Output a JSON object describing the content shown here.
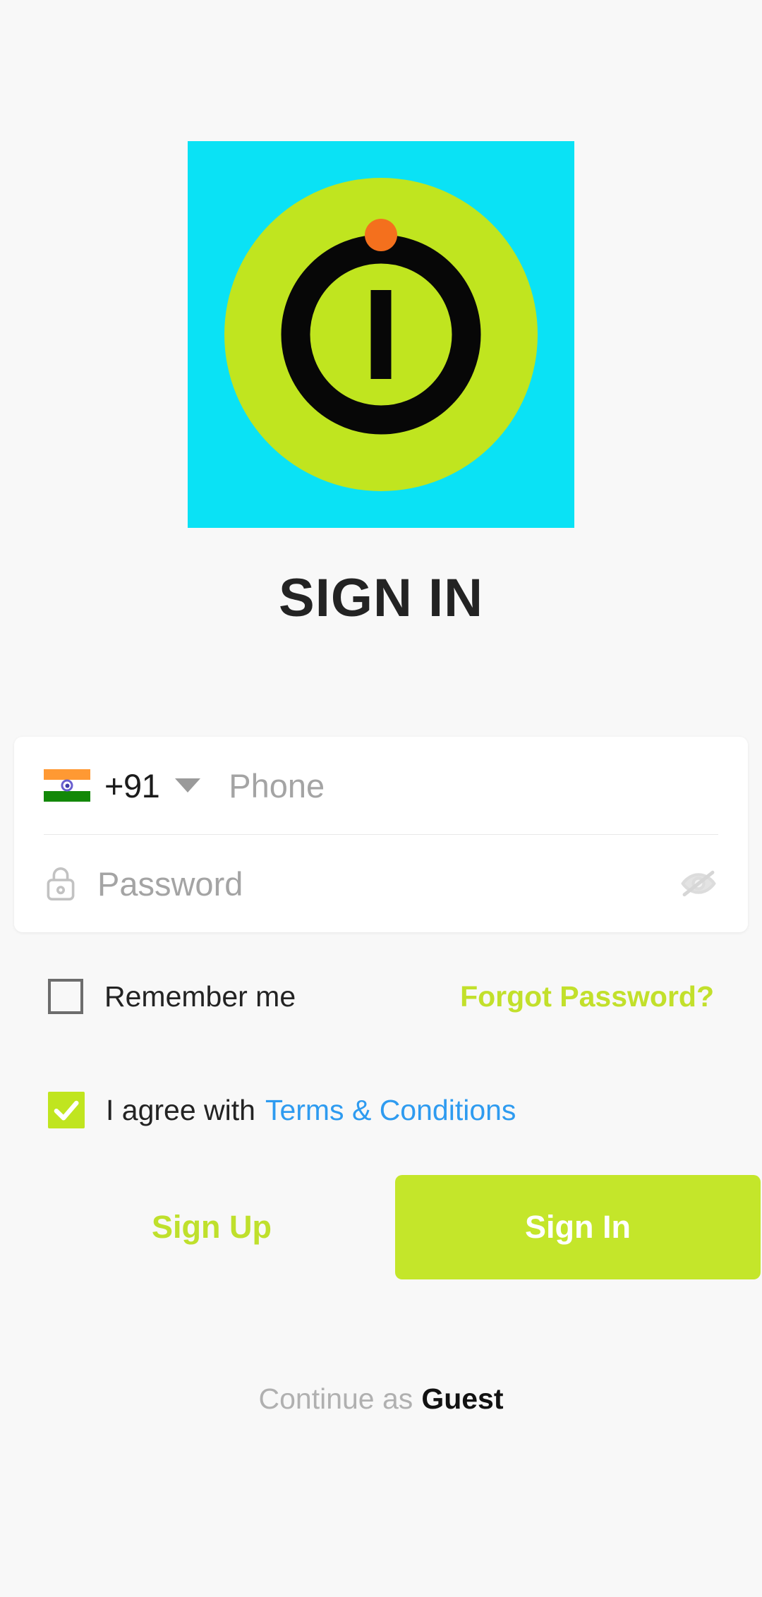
{
  "app": {
    "background_color": "#f8f8f8",
    "accent_color": "#c4e62a",
    "link_color": "#2e9bf0"
  },
  "logo": {
    "square_color": "#0ae2f5",
    "circle_color": "#c0e51f",
    "ring_color": "#070707",
    "dot_color": "#f4701d",
    "bar_color": "#070707",
    "alt": "app-logo"
  },
  "header": {
    "title": "SIGN IN"
  },
  "form": {
    "phone": {
      "flag": "india-flag-icon",
      "dial_code": "+91",
      "dropdown_icon": "chevron-down-icon",
      "placeholder": "Phone",
      "value": ""
    },
    "password": {
      "lock_icon": "lock-icon",
      "placeholder": "Password",
      "value": "",
      "toggle_icon": "eye-off-icon"
    }
  },
  "options": {
    "remember_me": {
      "label": "Remember me",
      "checked": false
    },
    "forgot_password": {
      "label": "Forgot Password?",
      "color": "#c2e02b"
    },
    "terms": {
      "checked": true,
      "prefix": "I agree with",
      "link_label": "Terms & Conditions",
      "link_color": "#2e9bf0",
      "checkbox_color": "#c0e51f"
    }
  },
  "actions": {
    "sign_up": {
      "label": "Sign Up",
      "color": "#bfe02c"
    },
    "sign_in": {
      "label": "Sign In",
      "background": "#c4e62a",
      "color": "#ffffff"
    }
  },
  "footer": {
    "guest_prefix": "Continue as",
    "guest_label": "Guest"
  }
}
